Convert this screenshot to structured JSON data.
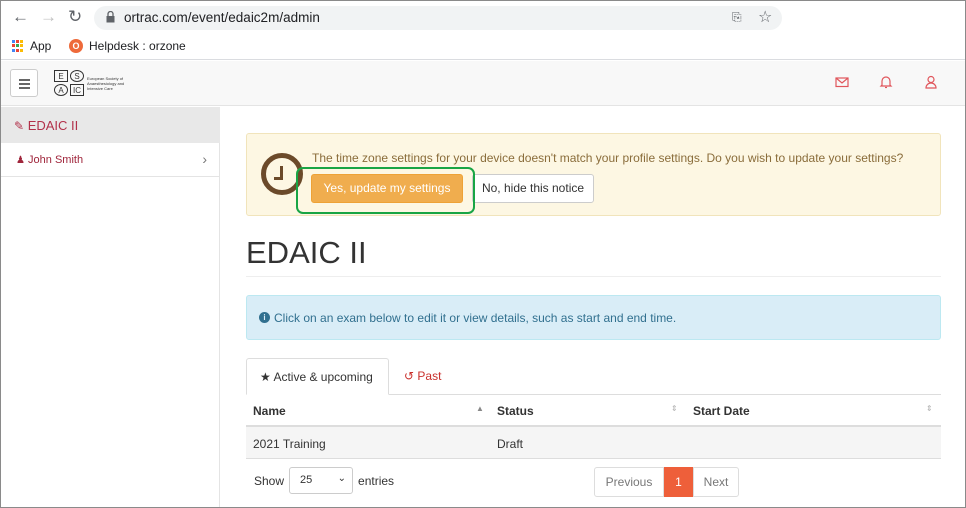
{
  "browser": {
    "url": "ortrac.com/event/edaic2m/admin",
    "bookmarks": [
      {
        "label": "App",
        "icon": "apps-grid-icon"
      },
      {
        "label": "Helpdesk : orzone",
        "icon": "orzone-favicon-icon"
      }
    ]
  },
  "logo": {
    "letters": [
      "E",
      "S",
      "A",
      "IC"
    ],
    "text": "European Society of Anaesthesiology and Intensive Care"
  },
  "header": {
    "icons": [
      "envelope-icon",
      "bell-icon",
      "user-icon"
    ]
  },
  "sidebar": {
    "active_label": "EDAIC II",
    "user_name": "John Smith"
  },
  "timezone_alert": {
    "message": "The time zone settings for your device doesn't match your profile settings. Do you wish to update your settings?",
    "yes_label": "Yes, update my settings",
    "no_label": "No, hide this notice"
  },
  "page": {
    "title": "EDAIC II",
    "info": "Click on an exam below to edit it or view details, such as start and end time."
  },
  "tabs": {
    "active": "Active & upcoming",
    "past": "Past"
  },
  "table": {
    "headers": [
      "Name",
      "Status",
      "Start Date"
    ],
    "rows": [
      {
        "name": "2021 Training",
        "status": "Draft",
        "start_date": ""
      }
    ]
  },
  "length_menu": {
    "prefix": "Show",
    "value": "25",
    "suffix": "entries"
  },
  "pagination": {
    "previous": "Previous",
    "current": "1",
    "next": "Next"
  },
  "colors": {
    "accent_red": "#b2314a",
    "warning_button": "#f0ad4e",
    "highlight_box": "#19a545",
    "pager_active": "#ee5f3a"
  }
}
